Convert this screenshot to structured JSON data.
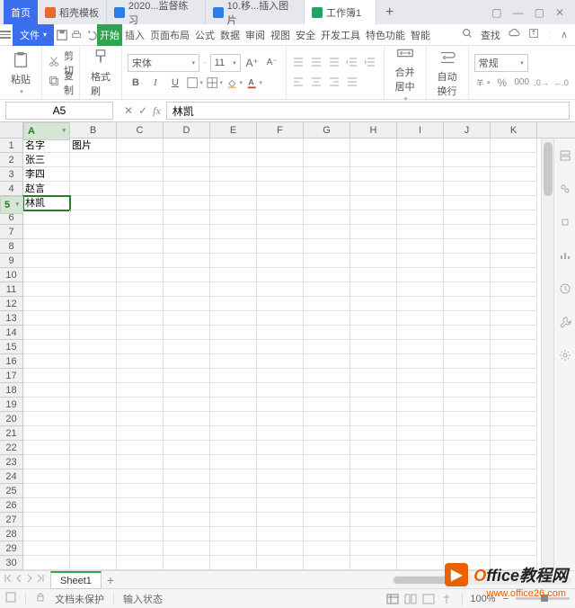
{
  "tabs": {
    "home": "首页",
    "t1": "稻壳模板",
    "t2": "2020...监督练习",
    "t3": "10.移...插入图片",
    "t4": "工作簿1",
    "add": "+"
  },
  "menu": {
    "file": "文件",
    "items": [
      "开始",
      "插入",
      "页面布局",
      "公式",
      "数据",
      "审阅",
      "视图",
      "安全",
      "开发工具",
      "特色功能",
      "智能"
    ],
    "search": "查找"
  },
  "ribbon": {
    "paste": "粘贴",
    "cut": "剪切",
    "copy": "复制",
    "fmt": "格式刷",
    "font": "宋体",
    "size": "11",
    "merge": "合并居中",
    "wrap": "自动换行",
    "general": "常规",
    "B": "B",
    "I": "I",
    "U": "U"
  },
  "formula": {
    "namebox": "A5",
    "content": "林凯",
    "fx": "fx"
  },
  "columns": [
    "A",
    "B",
    "C",
    "D",
    "E",
    "F",
    "G",
    "H",
    "I",
    "J",
    "K"
  ],
  "rows_count": 30,
  "active": {
    "row": 5,
    "col": 0
  },
  "data": {
    "1": [
      "名字",
      "图片"
    ],
    "2": [
      "张三"
    ],
    "3": [
      "李四"
    ],
    "4": [
      "赵言"
    ],
    "5": [
      "林凯"
    ]
  },
  "sheet": {
    "name": "Sheet1",
    "add": "+"
  },
  "status": {
    "protect": "文档未保护",
    "input": "输入状态",
    "zoom": "100%"
  },
  "watermark": {
    "brand_prefix": "O",
    "brand_rest": "ffice教程网",
    "url": "www.office26.com"
  }
}
